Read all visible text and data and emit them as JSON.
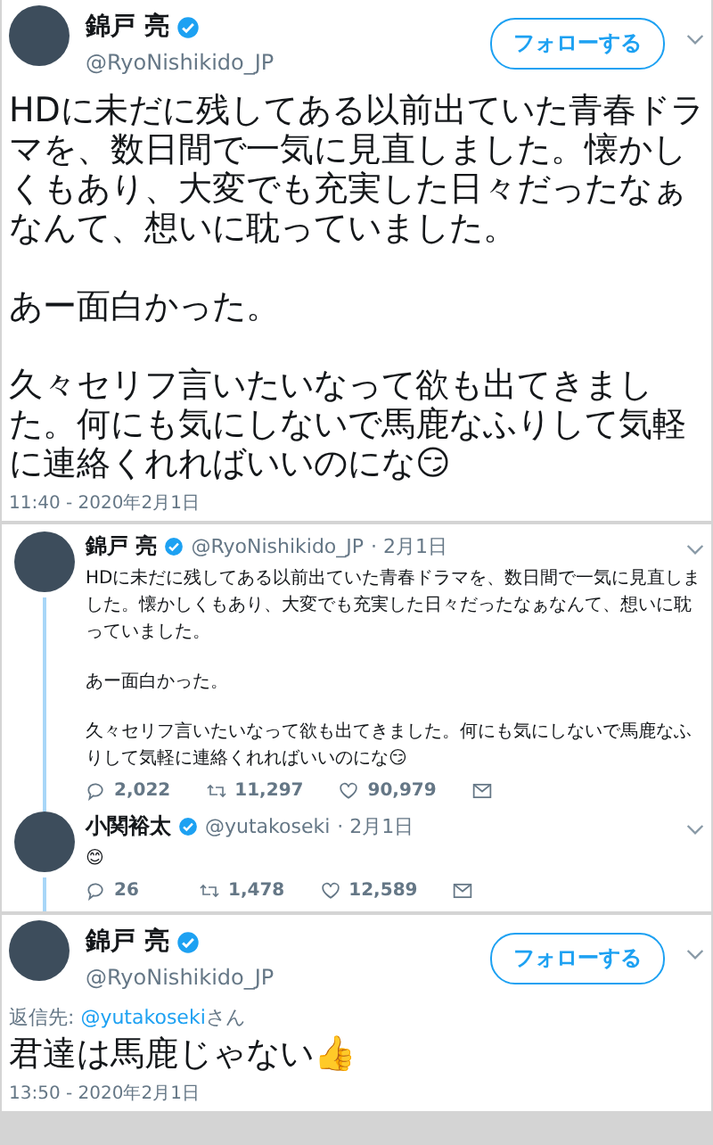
{
  "panels": [
    {
      "kind": "tweet",
      "author": {
        "name": "錦戸 亮",
        "verified": true,
        "handle": "@RyoNishikido_JP"
      },
      "follow_button": "フォローする",
      "paragraphs": [
        "HDに未だに残してある以前出ていた青春ドラマを、数日間で一気に見直しました。懐かしくもあり、大変でも充実した日々だったなぁなんて、想いに耽っていました。",
        "あー面白かった。",
        "久々セリフ言いたいなって欲も出てきました。何にも気にしないで馬鹿なふりして気軽に連絡くれればいいのにな😏"
      ],
      "timestamp": "11:40 - 2020年2月1日"
    },
    {
      "kind": "thread",
      "tweets": [
        {
          "author": {
            "name": "錦戸 亮",
            "verified": true,
            "handle": "@RyoNishikido_JP"
          },
          "date": "· 2月1日",
          "paragraphs": [
            "HDに未だに残してある以前出ていた青春ドラマを、数日間で一気に見直しました。懐かしくもあり、大変でも充実した日々だったなぁなんて、想いに耽っていました。",
            "あー面白かった。",
            "久々セリフ言いたいなって欲も出てきました。何にも気にしないで馬鹿なふりして気軽に連絡くれればいいのにな😏"
          ],
          "stats": {
            "replies": "2,022",
            "retweets": "11,297",
            "likes": "90,979"
          }
        },
        {
          "author": {
            "name": "小関裕太",
            "verified": true,
            "handle": "@yutakoseki"
          },
          "date": "· 2月1日",
          "paragraphs": [
            "😊"
          ],
          "stats": {
            "replies": "26",
            "retweets": "1,478",
            "likes": "12,589"
          }
        }
      ]
    },
    {
      "kind": "tweet",
      "author": {
        "name": "錦戸 亮",
        "verified": true,
        "handle": "@RyoNishikido_JP"
      },
      "follow_button": "フォローする",
      "reply_to": {
        "label": "返信先:",
        "handle": "@yutakoseki",
        "suffix": "さん"
      },
      "paragraphs": [
        "君達は馬鹿じゃない👍"
      ],
      "timestamp": "13:50 - 2020年2月1日"
    }
  ]
}
